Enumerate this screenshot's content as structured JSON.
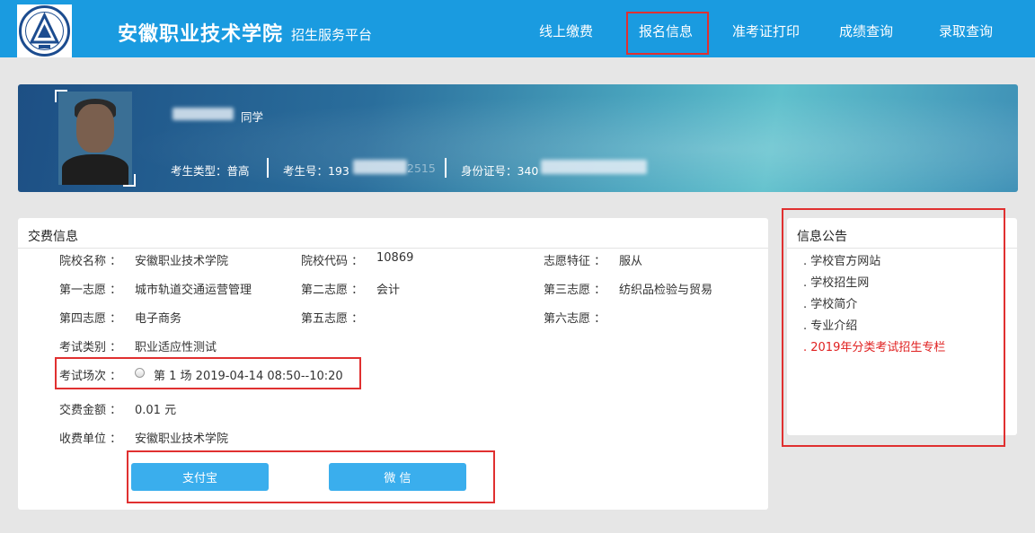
{
  "header": {
    "logo_icon": "school-emblem-icon",
    "school_name": "安徽职业技术学院",
    "platform_name": "招生服务平台",
    "nav": [
      "线上缴费",
      "报名信息",
      "准考证打印",
      "成绩查询",
      "录取查询"
    ],
    "active_nav": "报名信息",
    "bg_color": "#1a9be0"
  },
  "student": {
    "name_suffix": "同学",
    "type_text": "考生类型：普高",
    "exam_no_prefix": "考生号：193",
    "exam_no_suffix": "2515",
    "id_prefix": "身份证号：340"
  },
  "fee_panel": {
    "title": "交费信息",
    "rows": {
      "school_name_label": "院校名称 ：",
      "school_name": "安徽职业技术学院",
      "school_code_label": "院校代码 ：",
      "school_code": "10869",
      "wish_feature_label": "志愿特征 ：",
      "wish_feature": "服从",
      "wish1_label": "第一志愿 ：",
      "wish1": "城市轨道交通运营管理",
      "wish2_label": "第二志愿 ：",
      "wish2": "会计",
      "wish3_label": "第三志愿 ：",
      "wish3": "纺织品检验与贸易",
      "wish4_label": "第四志愿 ：",
      "wish4": "电子商务",
      "wish5_label": "第五志愿 ：",
      "wish6_label": "第六志愿 ：",
      "exam_type_label": "考试类别 ：",
      "exam_type": "职业适应性测试",
      "session_label": "考试场次 ：",
      "session_value": "第 1 场  2019-04-14   08:50--10:20",
      "amount_label": "交费金额 ：",
      "amount": "0.01  元",
      "payee_label": "收费单位 ：",
      "payee": "安徽职业技术学院"
    },
    "buttons": {
      "alipay": "支付宝",
      "wechat": "微  信"
    },
    "button_color": "#3aaeed"
  },
  "notice_panel": {
    "title": "信息公告",
    "items": [
      ". 学校官方网站",
      ". 学校招生网",
      ". 学校简介",
      ". 专业介绍",
      ". 2019年分类考试招生专栏"
    ],
    "highlight_color": "#e02020"
  },
  "annotation_color": "#e03030"
}
